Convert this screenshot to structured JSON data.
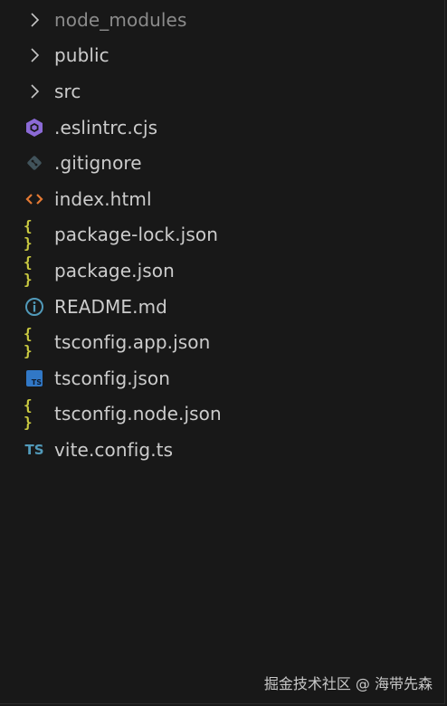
{
  "explorer": {
    "items": [
      {
        "label": "node_modules",
        "type": "folder",
        "icon": "chevron-right-icon",
        "dim": true
      },
      {
        "label": "public",
        "type": "folder",
        "icon": "chevron-right-icon"
      },
      {
        "label": "src",
        "type": "folder",
        "icon": "chevron-right-icon"
      },
      {
        "label": ".eslintrc.cjs",
        "type": "file",
        "icon": "eslint-icon"
      },
      {
        "label": ".gitignore",
        "type": "file",
        "icon": "git-icon"
      },
      {
        "label": "index.html",
        "type": "file",
        "icon": "html-icon"
      },
      {
        "label": "package-lock.json",
        "type": "file",
        "icon": "json-icon"
      },
      {
        "label": "package.json",
        "type": "file",
        "icon": "json-icon"
      },
      {
        "label": "README.md",
        "type": "file",
        "icon": "info-icon"
      },
      {
        "label": "tsconfig.app.json",
        "type": "file",
        "icon": "json-icon"
      },
      {
        "label": "tsconfig.json",
        "type": "file",
        "icon": "tsconfig-icon"
      },
      {
        "label": "tsconfig.node.json",
        "type": "file",
        "icon": "json-icon"
      },
      {
        "label": "vite.config.ts",
        "type": "file",
        "icon": "typescript-icon"
      }
    ],
    "icon_glyphs": {
      "json": "{ }",
      "ts_box": "TS",
      "ts_text": "TS"
    }
  },
  "watermark": "掘金技术社区 @ 海带先森",
  "colors": {
    "background": "#181818",
    "text": "#cccccc",
    "dim_text": "#8b8b8b",
    "json": "#cbcb41",
    "html": "#e37933",
    "eslint": "#8b6ad6",
    "git": "#41535b",
    "info": "#519aba",
    "typescript": "#3178c6"
  }
}
